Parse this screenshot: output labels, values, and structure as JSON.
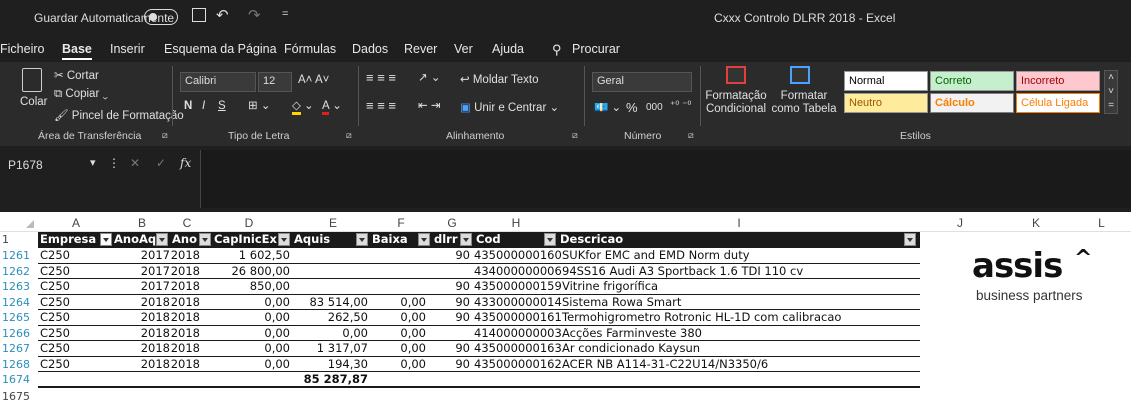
{
  "titlebar": {
    "autosave": "Guardar Automaticamente",
    "title": "Cxxx Controlo DLRR 2018  -  Excel"
  },
  "menu": [
    "Ficheiro",
    "Base",
    "Inserir",
    "Esquema da Página",
    "Fórmulas",
    "Dados",
    "Rever",
    "Ver",
    "Ajuda"
  ],
  "search": "Procurar",
  "clipboard": {
    "paste": "Colar",
    "cut": "Cortar",
    "copy": "Copiar",
    "format_painter": "Pincel de Formatação",
    "group": "Área de Transferência"
  },
  "font": {
    "name": "Calibri",
    "size": "12",
    "group": "Tipo de Letra",
    "bold": "N",
    "italic": "I",
    "underline": "S"
  },
  "alignment": {
    "wrap": "Moldar Texto",
    "merge": "Unir e Centrar",
    "group": "Alinhamento"
  },
  "number": {
    "format": "Geral",
    "group": "Número",
    "pct": "%",
    "thousands": "000"
  },
  "styles": {
    "cond": "Formatação Condicional",
    "table": "Formatar como Tabela",
    "group": "Estilos",
    "normal": "Normal",
    "correto": "Correto",
    "incorreto": "Incorreto",
    "neutro": "Neutro",
    "calculo": "Cálculo",
    "celula": "Célula Ligada"
  },
  "formula": {
    "namebox": "P1678",
    "fx": "fx"
  },
  "columns": [
    "A",
    "B",
    "C",
    "D",
    "E",
    "F",
    "G",
    "H",
    "I",
    "J",
    "K",
    "L"
  ],
  "table": {
    "headers": [
      "Empresa",
      "AnoAq",
      "Ano",
      "CapInicEx",
      "Aquis",
      "Baixa",
      "dlrr",
      "Cod",
      "Descricao"
    ],
    "rows": [
      {
        "rn": "1261",
        "a": "C250",
        "b": "2017",
        "c": "2018",
        "d": "1 602,50",
        "e": "",
        "f": "",
        "g": "90",
        "h": "435000000160",
        "i": "SUKfor EMC and EMD Norm duty"
      },
      {
        "rn": "1262",
        "a": "C250",
        "b": "2017",
        "c": "2018",
        "d": "26 800,00",
        "e": "",
        "f": "",
        "g": "",
        "h": "434000000006",
        "i": "94SS16 Audi A3 Sportback 1.6 TDI 110 cv"
      },
      {
        "rn": "1263",
        "a": "C250",
        "b": "2017",
        "c": "2018",
        "d": "850,00",
        "e": "",
        "f": "",
        "g": "90",
        "h": "435000000159",
        "i": "Vitrine frigorífica"
      },
      {
        "rn": "1264",
        "a": "C250",
        "b": "2018",
        "c": "2018",
        "d": "0,00",
        "e": "83 514,00",
        "f": "0,00",
        "g": "90",
        "h": "433000000014",
        "i": "Sistema Rowa Smart"
      },
      {
        "rn": "1265",
        "a": "C250",
        "b": "2018",
        "c": "2018",
        "d": "0,00",
        "e": "262,50",
        "f": "0,00",
        "g": "90",
        "h": "435000000161",
        "i": "Termohigrometro Rotronic HL-1D com calibracao"
      },
      {
        "rn": "1266",
        "a": "C250",
        "b": "2018",
        "c": "2018",
        "d": "0,00",
        "e": "0,00",
        "f": "0,00",
        "g": "",
        "h": "414000000003",
        "i": "Acções Farminveste 380"
      },
      {
        "rn": "1267",
        "a": "C250",
        "b": "2018",
        "c": "2018",
        "d": "0,00",
        "e": "1 317,07",
        "f": "0,00",
        "g": "90",
        "h": "435000000163",
        "i": "Ar condicionado Kaysun"
      },
      {
        "rn": "1268",
        "a": "C250",
        "b": "2018",
        "c": "2018",
        "d": "0,00",
        "e": "194,30",
        "f": "0,00",
        "g": "90",
        "h": "435000000162",
        "i": "ACER NB A114-31-C22U14/N3350/6"
      }
    ],
    "total_row": "1674",
    "total": "85 287,87",
    "next_row": "1675",
    "header_row": "1"
  },
  "logo": {
    "brand": "assis",
    "tagline": "business partners"
  }
}
